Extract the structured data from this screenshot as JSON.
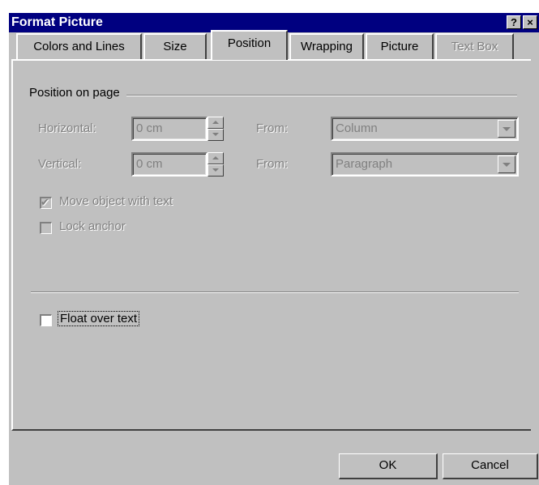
{
  "window": {
    "title": "Format Picture",
    "help_label": "?",
    "close_label": "×"
  },
  "tabs": [
    {
      "label": "Colors and Lines",
      "state": "normal"
    },
    {
      "label": "Size",
      "state": "normal"
    },
    {
      "label": "Position",
      "state": "active"
    },
    {
      "label": "Wrapping",
      "state": "normal"
    },
    {
      "label": "Picture",
      "state": "normal"
    },
    {
      "label": "Text Box",
      "state": "disabled"
    }
  ],
  "position_group": {
    "label": "Position on page",
    "horizontal": {
      "label": "Horizontal:",
      "value": "0 cm",
      "from_label": "From:",
      "from_value": "Column"
    },
    "vertical": {
      "label": "Vertical:",
      "value": "0 cm",
      "from_label": "From:",
      "from_value": "Paragraph"
    },
    "move_with_text": {
      "label": "Move object with text",
      "checked": true,
      "enabled": false
    },
    "lock_anchor": {
      "label": "Lock anchor",
      "checked": false,
      "enabled": false
    }
  },
  "float_over_text": {
    "label": "Float over text",
    "checked": false
  },
  "buttons": {
    "ok": "OK",
    "cancel": "Cancel"
  }
}
